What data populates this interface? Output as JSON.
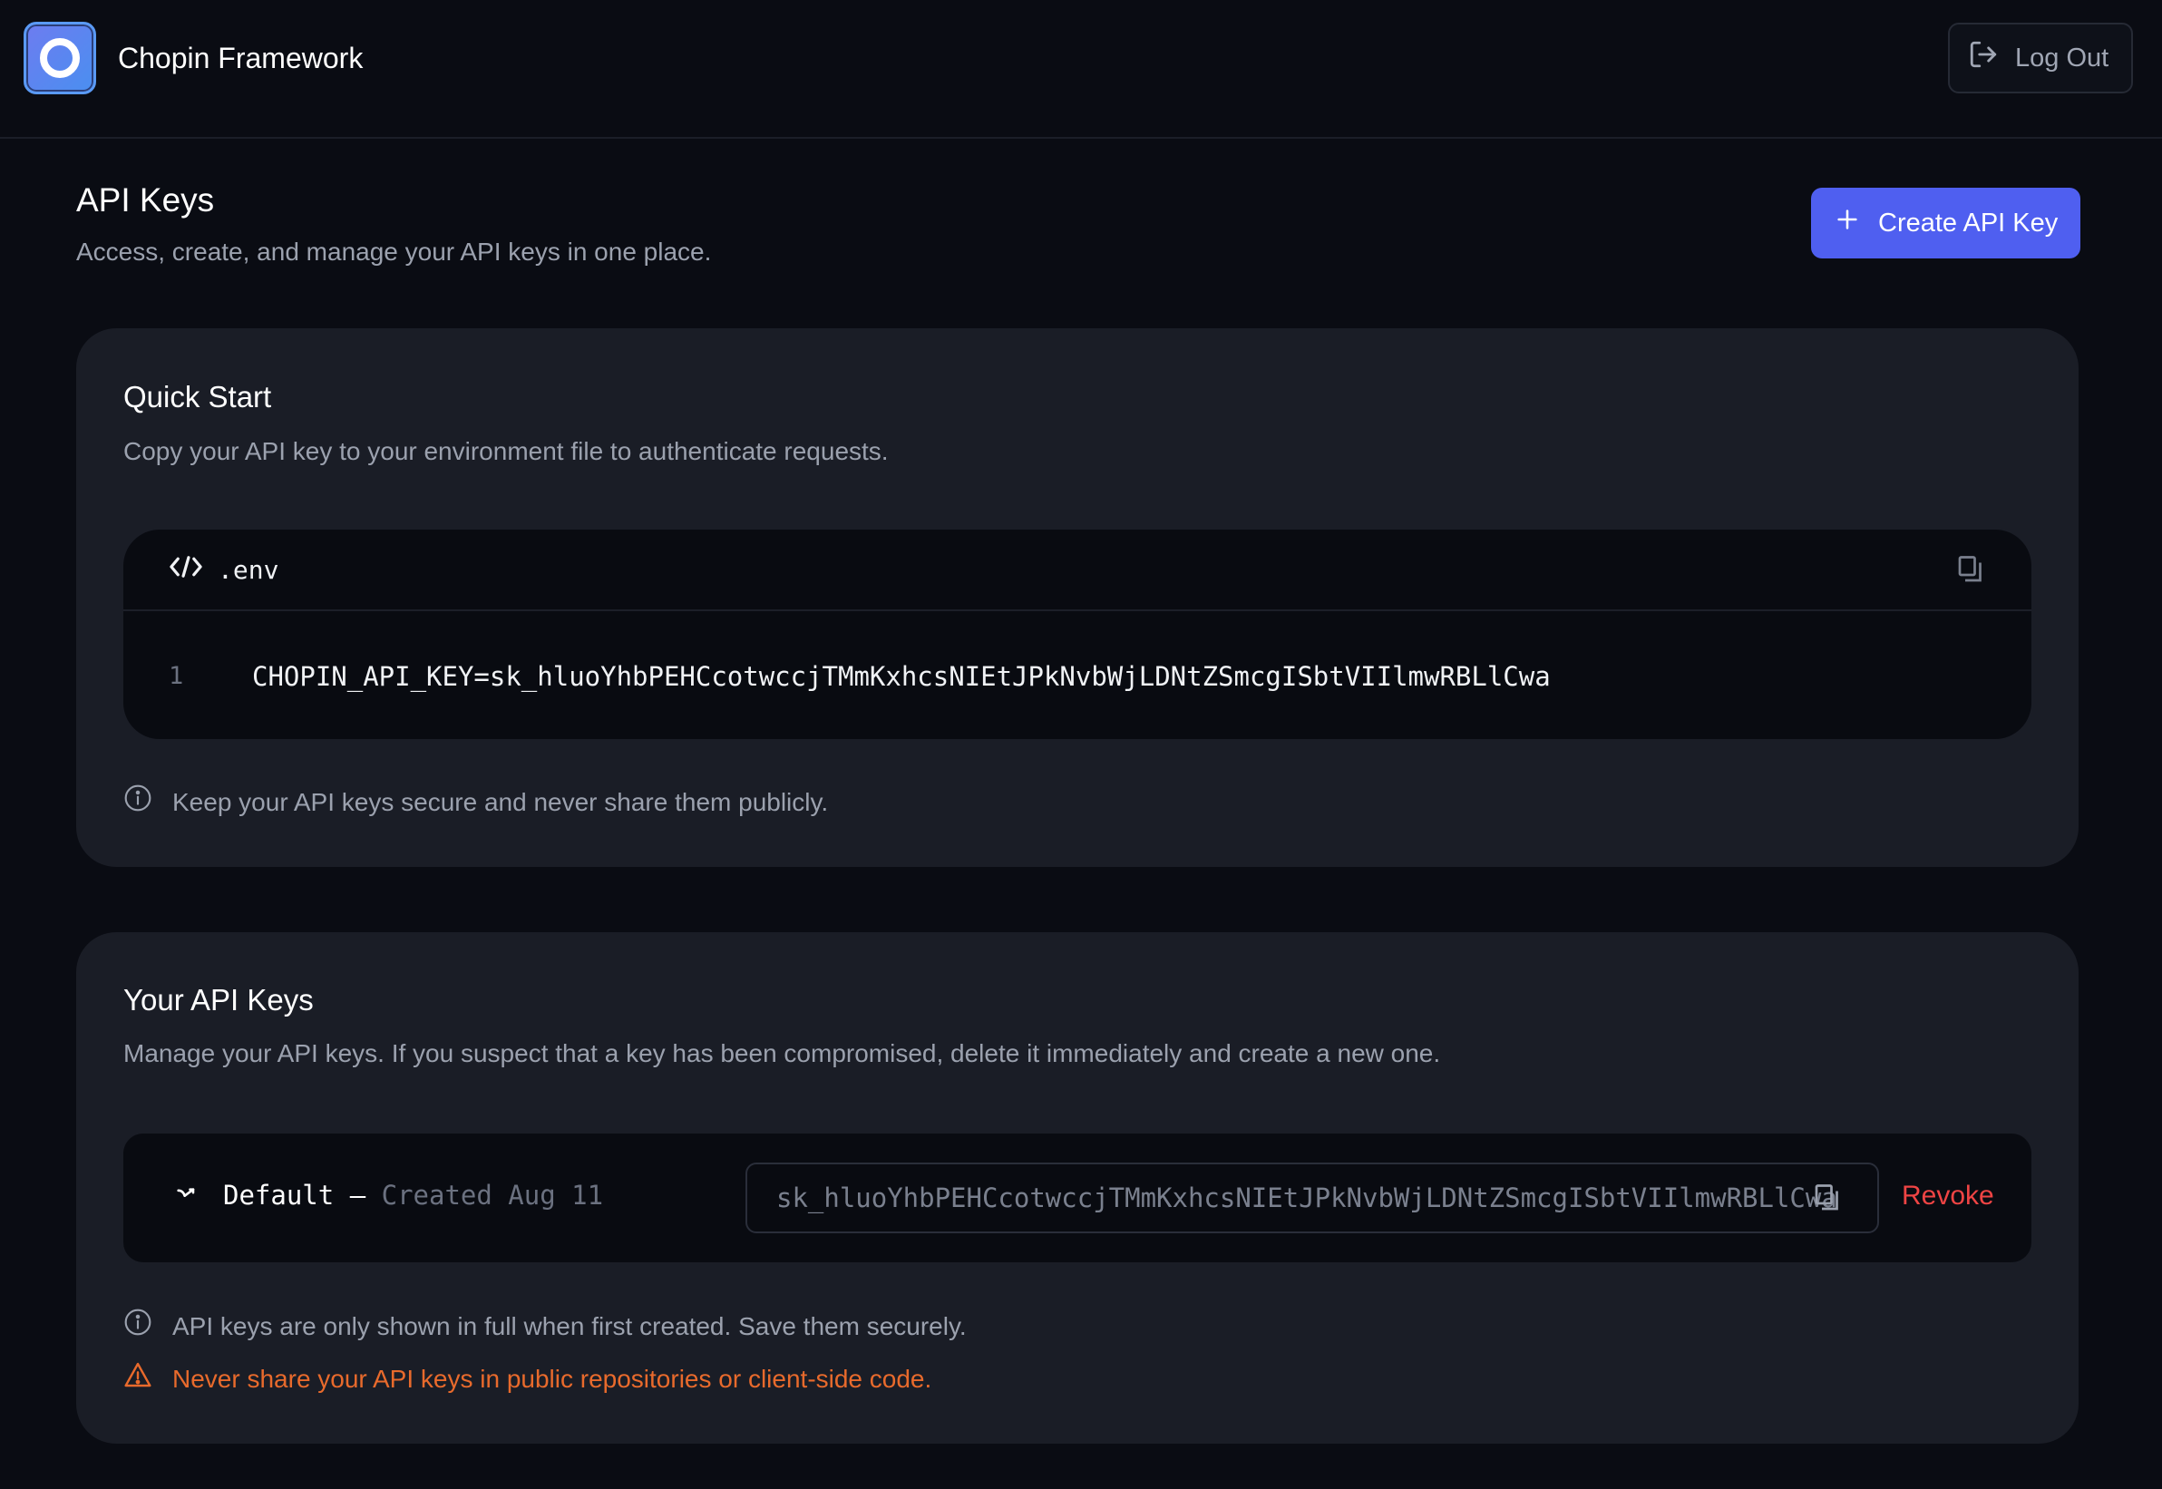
{
  "app": {
    "title": "Chopin Framework"
  },
  "header": {
    "logout_label": "Log Out"
  },
  "page": {
    "title": "API Keys",
    "subtitle": "Access, create, and manage your API keys in one place.",
    "create_label": "Create API Key"
  },
  "quickstart": {
    "title": "Quick Start",
    "subtitle": "Copy your API key to your environment file to authenticate requests.",
    "filename": ".env",
    "line_number": "1",
    "code": "CHOPIN_API_KEY=sk_hluoYhbPEHCcotwccjTMmKxhcsNIEtJPkNvbWjLDNtZSmcgISbtVIIlmwRBLlCwa",
    "note": "Keep your API keys secure and never share them publicly."
  },
  "keys": {
    "title": "Your API Keys",
    "subtitle": "Manage your API keys. If you suspect that a key has been compromised, delete it immediately and create a new one.",
    "items": [
      {
        "name": "Default",
        "separator": "–",
        "created": "Created Aug 11",
        "value": "sk_hluoYhbPEHCcotwccjTMmKxhcsNIEtJPkNvbWjLDNtZSmcgISbtVIIlmwRBLlCwa",
        "revoke_label": "Revoke"
      }
    ],
    "info_note": "API keys are only shown in full when first created. Save them securely.",
    "warn_note": "Never share your API keys in public repositories or client-side code."
  },
  "colors": {
    "background": "#0a0c13",
    "card": "#1a1d26",
    "accent": "#4f5ff0",
    "danger": "#ef4444",
    "warning": "#e86a2c"
  },
  "icons": {
    "logo": "app-logo-icon",
    "logout": "logout-icon",
    "create": "plus-icon",
    "code": "code-icon",
    "copy": "copy-icon",
    "key": "key-icon",
    "info": "info-icon",
    "warning": "warning-icon"
  }
}
